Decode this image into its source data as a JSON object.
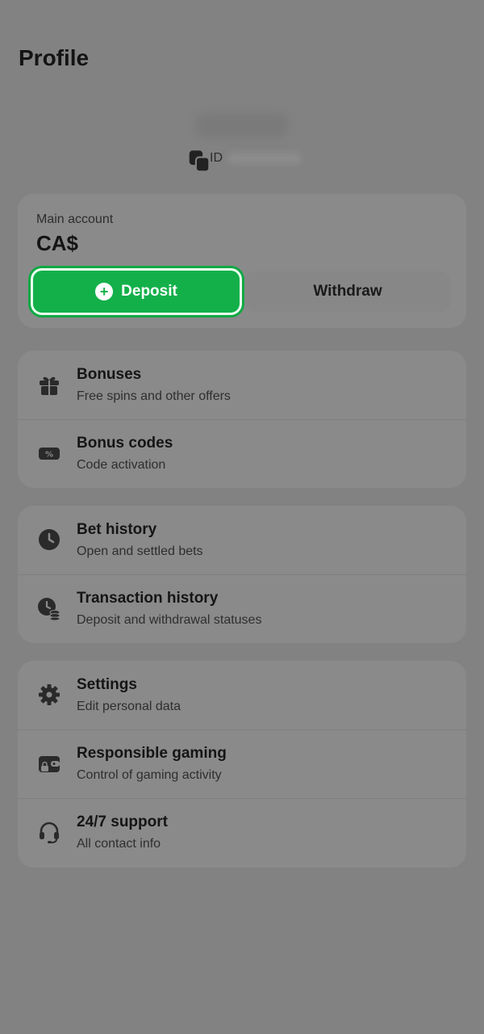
{
  "header": {
    "title": "Profile"
  },
  "user": {
    "id_label": "ID"
  },
  "account": {
    "label": "Main account",
    "balance": "CA$",
    "deposit_label": "Deposit",
    "withdraw_label": "Withdraw"
  },
  "groups": [
    {
      "items": [
        {
          "title": "Bonuses",
          "subtitle": "Free spins and other offers",
          "icon": "gift-icon"
        },
        {
          "title": "Bonus codes",
          "subtitle": "Code activation",
          "icon": "coupon-icon"
        }
      ]
    },
    {
      "items": [
        {
          "title": "Bet history",
          "subtitle": "Open and settled bets",
          "icon": "clock-icon"
        },
        {
          "title": "Transaction history",
          "subtitle": "Deposit and withdrawal statuses",
          "icon": "clock-coins-icon"
        }
      ]
    },
    {
      "items": [
        {
          "title": "Settings",
          "subtitle": "Edit personal data",
          "icon": "gear-icon"
        },
        {
          "title": "Responsible gaming",
          "subtitle": "Control of gaming activity",
          "icon": "wallet-lock-icon"
        },
        {
          "title": "24/7 support",
          "subtitle": "All contact info",
          "icon": "headset-icon"
        }
      ]
    }
  ],
  "colors": {
    "accent": "#13b04a",
    "background": "#828282",
    "card": "#8a8a8a"
  }
}
